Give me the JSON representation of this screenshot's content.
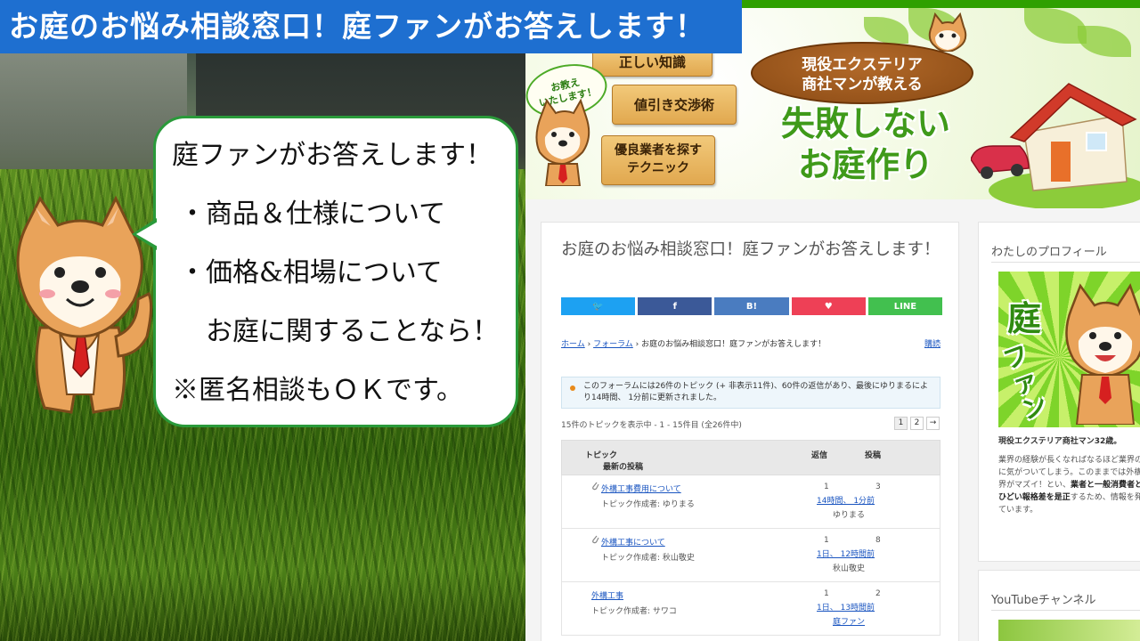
{
  "banner": {
    "title": "お庭のお悩み相談窓口！庭ファンがお答えします！"
  },
  "bubble": {
    "lines": [
      "庭ファンがお答えします！",
      "・商品＆仕様について",
      "・価格&相場について",
      "お庭に関することなら！",
      "※匿名相談もＯＫです。"
    ]
  },
  "header": {
    "planks": [
      "正しい知識",
      "値引き交渉術",
      "優良業者を探す",
      "テクニック"
    ],
    "callout": [
      "お教え",
      "いたします！"
    ],
    "oval_sign": [
      "現役エクステリア",
      "商社マンが教える"
    ],
    "big_title": [
      "失敗しない",
      "お庭作り"
    ]
  },
  "post": {
    "title": "お庭のお悩み相談窓口！庭ファンがお答えします！",
    "share": [
      {
        "label": "🐦",
        "color": "#1da1f2"
      },
      {
        "label": "f",
        "color": "#3b5998"
      },
      {
        "label": "B!",
        "color": "#4a7cc0"
      },
      {
        "label": "♥",
        "color": "#ee4056"
      },
      {
        "label": "LINE",
        "color": "#42c04f"
      }
    ],
    "breadcrumb": {
      "home": "ホーム",
      "sep": " › ",
      "forum": "フォーラム",
      "current": "お庭のお悩み相談窓口！庭ファンがお答えします！"
    },
    "subscribe": "購読",
    "notice": "このフォーラムには26件のトピック (+ 非表示11件)、60件の返信があり、最後にゆりまるにより14時間、 1分前に更新されました。",
    "count_line": "15件のトピックを表示中 - 1 - 15件目 (全26件中)",
    "pager": [
      "1",
      "2",
      "→"
    ],
    "table_headers": {
      "topic": "トピック",
      "latest": "最新の投稿",
      "replies": "返信",
      "posts": "投稿"
    },
    "rows": [
      {
        "title": "外構工事費用について",
        "author": "トピック作成者: ゆりまる",
        "replies": "1",
        "posts": "3",
        "freshness": "14時間、 1分前",
        "last_by": "ゆりまる",
        "has_clip": true
      },
      {
        "title": "外構工事について",
        "author": "トピック作成者: 秋山敬史",
        "replies": "1",
        "posts": "8",
        "freshness": "1日、 12時間前",
        "last_by": "秋山敬史",
        "has_clip": true
      },
      {
        "title": "外構工事",
        "author": "トピック作成者: サワコ",
        "replies": "1",
        "posts": "2",
        "freshness": "1日、 13時間前",
        "last_by": "庭ファン",
        "has_clip": false
      }
    ]
  },
  "sidebar": {
    "profile_heading": "わたしのプロフィール",
    "profile_image_text": {
      "k1": "庭",
      "k2": "ファン"
    },
    "profile_name": "現役エクステリア商社マン32歳。",
    "profile_text_1": "業界の経験が長くなればなるほど業界の闇に気がついてしまう。このままでは外構業界がマズイ！とい、",
    "profile_text_bold": "業者と一般消費者とのひどい報格差を是正",
    "profile_text_2": "するため、情報を発しています。",
    "youtube_heading": "YouTubeチャンネル"
  },
  "colors": {
    "banner_blue": "#1e6fd0",
    "bubble_green": "#2a9a3a",
    "link_blue": "#1a55c0",
    "brand_green": "#3f9a1a"
  }
}
